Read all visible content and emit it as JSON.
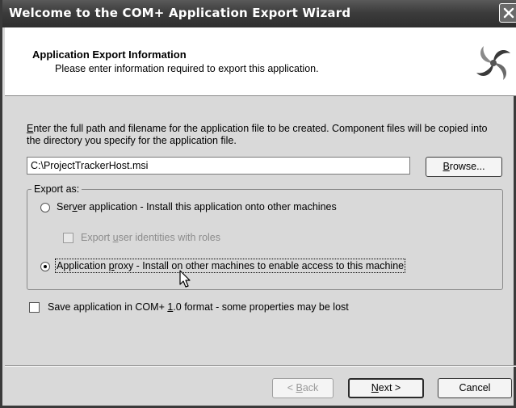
{
  "window": {
    "title": "Welcome to the COM+ Application Export Wizard"
  },
  "header": {
    "title": "Application Export Information",
    "subtitle": "Please enter information required to export this application.",
    "logo_icon": "com-plus-swirl-icon"
  },
  "instructions": {
    "first_letter": "E",
    "rest": "nter the full path and filename for the application file to be created.  Component files will be copied into the directory you specify for the application file."
  },
  "path_field": {
    "value": "C:\\ProjectTrackerHost.msi"
  },
  "browse_button": {
    "accel": "B",
    "rest": "rowse..."
  },
  "export_as": {
    "legend": "Export as:",
    "server_option": {
      "pre": "Ser",
      "accel": "v",
      "post": "er application - Install this application onto other machines",
      "selected": false
    },
    "export_identities": {
      "pre": "Export ",
      "accel": "u",
      "post": "ser identities with roles",
      "checked": false,
      "enabled": false
    },
    "proxy_option": {
      "pre": "Application ",
      "accel": "p",
      "post": "roxy - Install on other machines to enable access to this machine",
      "selected": true
    }
  },
  "save_format": {
    "pre": "Save application in COM+ ",
    "accel": "1",
    "post": ".0 format - some properties may be lost",
    "checked": false
  },
  "footer": {
    "back": {
      "pre": "< ",
      "accel": "B",
      "post": "ack",
      "enabled": false
    },
    "next": {
      "accel": "N",
      "post": "ext >"
    },
    "cancel": "Cancel"
  },
  "colors": {
    "titlebar": "#3c3c3c",
    "dialog_bg": "#d9d9d9",
    "header_bg": "#ffffff"
  }
}
